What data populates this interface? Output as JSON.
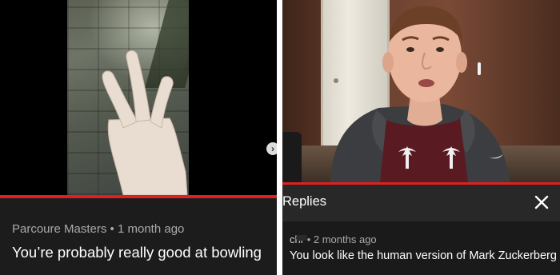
{
  "left_panel": {
    "video": {
      "progress": 1.0
    },
    "comment": {
      "author": "Parcoure Masters",
      "separator": "•",
      "time": "1 month ago",
      "text": "You’re probably really good at bowling"
    },
    "next_button_glyph": "›",
    "colors": {
      "progress": "#e02020",
      "comment_bg": "#1c1c1c",
      "meta_text": "#aaaaaa"
    }
  },
  "right_panel": {
    "video": {
      "progress": 1.0
    },
    "replies_header": {
      "title": "Replies",
      "close_icon": "close-icon"
    },
    "reply": {
      "author": "chr",
      "separator": "•",
      "time": "2 months ago",
      "text": "You look like the human version of Mark Zuckerberg"
    },
    "colors": {
      "progress": "#e02020",
      "header_bg": "#282828",
      "reply_bg": "#1a1a1a"
    }
  }
}
